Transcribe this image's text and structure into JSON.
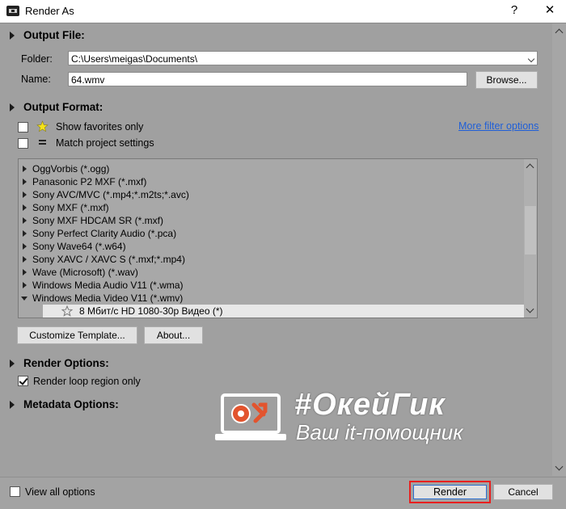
{
  "window": {
    "title": "Render As",
    "help_label": "?",
    "close_label": "✕"
  },
  "output_file": {
    "section_title": "Output File:",
    "folder_label": "Folder:",
    "folder_value": "C:\\Users\\meigas\\Documents\\",
    "name_label": "Name:",
    "name_value": "64.wmv",
    "browse_label": "Browse..."
  },
  "output_format": {
    "section_title": "Output Format:",
    "show_favorites_label": "Show favorites only",
    "show_favorites_checked": false,
    "match_project_label": "Match project settings",
    "match_project_checked": false,
    "more_filter_label": "More filter options",
    "formats": [
      {
        "label": "OggVorbis (*.ogg)",
        "expanded": false
      },
      {
        "label": "Panasonic P2 MXF (*.mxf)",
        "expanded": false
      },
      {
        "label": "Sony AVC/MVC (*.mp4;*.m2ts;*.avc)",
        "expanded": false
      },
      {
        "label": "Sony MXF (*.mxf)",
        "expanded": false
      },
      {
        "label": "Sony MXF HDCAM SR (*.mxf)",
        "expanded": false
      },
      {
        "label": "Sony Perfect Clarity Audio (*.pca)",
        "expanded": false
      },
      {
        "label": "Sony Wave64 (*.w64)",
        "expanded": false
      },
      {
        "label": "Sony XAVC / XAVC S (*.mxf;*.mp4)",
        "expanded": false
      },
      {
        "label": "Wave (Microsoft) (*.wav)",
        "expanded": false
      },
      {
        "label": "Windows Media Audio V11 (*.wma)",
        "expanded": false
      },
      {
        "label": "Windows Media Video V11 (*.wmv)",
        "expanded": true
      }
    ],
    "template_label": "8 Мбит/с HD 1080-30p Видео (*)",
    "customize_label": "Customize Template...",
    "about_label": "About..."
  },
  "render_options": {
    "section_title": "Render Options:",
    "loop_region_label": "Render loop region only",
    "loop_region_checked": true
  },
  "metadata_options": {
    "section_title": "Metadata Options:"
  },
  "footer": {
    "view_all_label": "View all options",
    "view_all_checked": false,
    "render_label": "Render",
    "cancel_label": "Cancel"
  },
  "watermark": {
    "title": "#ОкейГик",
    "subtitle": "Ваш it-помощник"
  },
  "colors": {
    "link": "#1f5fd8",
    "highlight_border": "#e8201f",
    "background": "#a0a0a0"
  }
}
